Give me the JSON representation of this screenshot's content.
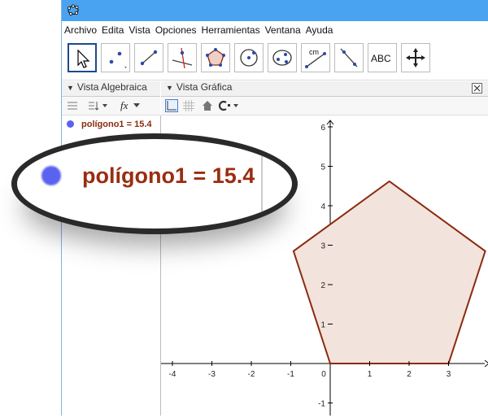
{
  "menu": [
    "Archivo",
    "Edita",
    "Vista",
    "Opciones",
    "Herramientas",
    "Ventana",
    "Ayuda"
  ],
  "tools": [
    {
      "name": "move-tool-icon"
    },
    {
      "name": "point-tool-icon"
    },
    {
      "name": "line-tool-icon"
    },
    {
      "name": "perpendicular-tool-icon"
    },
    {
      "name": "polygon-tool-icon"
    },
    {
      "name": "circle-tool-icon"
    },
    {
      "name": "conic-tool-icon"
    },
    {
      "name": "measure-tool-icon",
      "label": "cm"
    },
    {
      "name": "reflect-tool-icon"
    },
    {
      "name": "text-tool-icon",
      "label": "ABC"
    },
    {
      "name": "move-graphics-tool-icon"
    }
  ],
  "algebra_view": {
    "title": "Vista Algebraica",
    "fx_label": "fx",
    "items": [
      {
        "label": "polígono1 = 15.4",
        "color": "#5a62f0"
      }
    ]
  },
  "graphics_view": {
    "title": "Vista Gráfica",
    "x_ticks": [
      "-4",
      "-3",
      "-2",
      "-1",
      "0",
      "1",
      "2",
      "3"
    ],
    "y_ticks": [
      "6",
      "5",
      "4",
      "3",
      "2",
      "1",
      "-1"
    ],
    "polygon": {
      "name": "polígono1",
      "area": 15.4,
      "vertices": [
        [
          0,
          0
        ],
        [
          3,
          0
        ],
        [
          3.93,
          2.85
        ],
        [
          1.5,
          4.62
        ],
        [
          -0.93,
          2.85
        ]
      ],
      "stroke": "#8b2a0e",
      "fill": "#f3e3dd"
    }
  },
  "magnifier": {
    "label": "polígono1 = 15.4"
  },
  "colors": {
    "titlebar": "#4aa3f0",
    "point": "#5a62f0",
    "polygon_stroke": "#8b2a0e"
  }
}
